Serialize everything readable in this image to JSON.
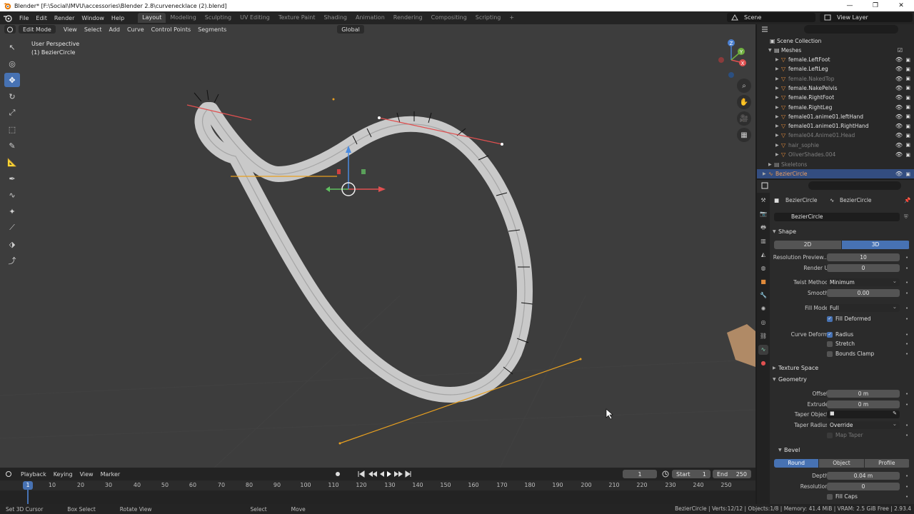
{
  "titlebar": {
    "title": "Blender* [F:\\Social\\IMVU\\accessories\\Blender 2.8\\curvenecklace (2).blend]",
    "minimize": "—",
    "maximize": "❐",
    "close": "✕"
  },
  "menu": [
    "File",
    "Edit",
    "Render",
    "Window",
    "Help"
  ],
  "workspaces": [
    "Layout",
    "Modeling",
    "Sculpting",
    "UV Editing",
    "Texture Paint",
    "Shading",
    "Animation",
    "Rendering",
    "Compositing",
    "Scripting"
  ],
  "workspace_add": "+",
  "scene": "Scene",
  "view_layer": "View Layer",
  "viewport": {
    "mode": "Edit Mode",
    "menus": [
      "View",
      "Select",
      "Add",
      "Curve",
      "Control Points",
      "Segments"
    ],
    "orientation": "Global",
    "info_line1": "User Perspective",
    "info_line2": "(1) BezierCircle",
    "gizmo_x": "X",
    "gizmo_y": "Y",
    "gizmo_z": "Z",
    "nav_icons": [
      "⌕",
      "✋",
      "🎥",
      "▦"
    ],
    "tools": [
      "↖",
      "◎",
      "✥",
      "↻",
      "⤢",
      "⬚",
      "✎",
      "📐",
      "✒",
      "∿",
      "✦",
      "⟋",
      "⬗",
      "⤴"
    ]
  },
  "timeline": {
    "menus": [
      "Playback",
      "Keying",
      "View",
      "Marker"
    ],
    "current_frame": "1",
    "start_label": "Start",
    "start": "1",
    "end_label": "End",
    "end": "250",
    "playhead": "1",
    "ruler": [
      "10",
      "20",
      "30",
      "40",
      "50",
      "60",
      "70",
      "80",
      "90",
      "100",
      "110",
      "120",
      "130",
      "140",
      "150",
      "160",
      "170",
      "180",
      "190",
      "200",
      "210",
      "220",
      "230",
      "240",
      "250"
    ]
  },
  "statusbar": {
    "hints": [
      "Set 3D Cursor",
      "Box Select",
      "Rotate View",
      "Select",
      "Move"
    ],
    "stats": "BezierCircle | Verts:12/12 | Objects:1/8 | Memory: 41.4 MiB | VRAM: 2.5 GiB Free | 2.93.4"
  },
  "outliner": {
    "scene_collection": "Scene Collection",
    "meshes": "Meshes",
    "items": [
      {
        "name": "female.LeftFoot",
        "dim": false
      },
      {
        "name": "female.LeftLeg",
        "dim": false
      },
      {
        "name": "female.NakedTop",
        "dim": true
      },
      {
        "name": "female.NakePelvis",
        "dim": false
      },
      {
        "name": "female.RightFoot",
        "dim": false
      },
      {
        "name": "female.RightLeg",
        "dim": false
      },
      {
        "name": "female01.anime01.leftHand",
        "dim": false
      },
      {
        "name": "female01.anime01.RightHand",
        "dim": false
      },
      {
        "name": "female04.Anime01.Head",
        "dim": true
      },
      {
        "name": "hair_sophie",
        "dim": true
      },
      {
        "name": "OliverShades.004",
        "dim": true
      }
    ],
    "skeletons": "Skeletons",
    "selected": "BezierCircle"
  },
  "properties": {
    "breadcrumb_object": "BezierCircle",
    "breadcrumb_data": "BezierCircle",
    "data_name": "BezierCircle",
    "shape_title": "Shape",
    "dim_2d": "2D",
    "dim_3d": "3D",
    "resolution_preview_label": "Resolution Preview...",
    "resolution_preview": "10",
    "render_u_label": "Render U",
    "render_u": "0",
    "twist_method_label": "Twist Method",
    "twist_method": "Minimum",
    "smooth_label": "Smooth",
    "smooth": "0.00",
    "fill_mode_label": "Fill Mode",
    "fill_mode": "Full",
    "fill_deformed": "Fill Deformed",
    "curve_deform_label": "Curve Deform",
    "radius": "Radius",
    "stretch": "Stretch",
    "bounds_clamp": "Bounds Clamp",
    "texture_space_title": "Texture Space",
    "geometry_title": "Geometry",
    "offset_label": "Offset",
    "offset": "0 m",
    "extrude_label": "Extrude",
    "extrude": "0 m",
    "taper_object_label": "Taper Object",
    "taper_radius_label": "Taper Radius",
    "taper_radius": "Override",
    "map_taper": "Map Taper",
    "bevel_title": "Bevel",
    "bevel_round": "Round",
    "bevel_object": "Object",
    "bevel_profile": "Profile",
    "depth_label": "Depth",
    "depth": "0.04 m",
    "resolution_label": "Resolution",
    "resolution": "0",
    "fill_caps": "Fill Caps",
    "check": "✓",
    "dot": "•"
  },
  "colors": {
    "accent": "#4772b3",
    "viewport_bg": "#3d3d3d",
    "handle_orange": "#e8a020",
    "handle_red": "#e05050"
  }
}
